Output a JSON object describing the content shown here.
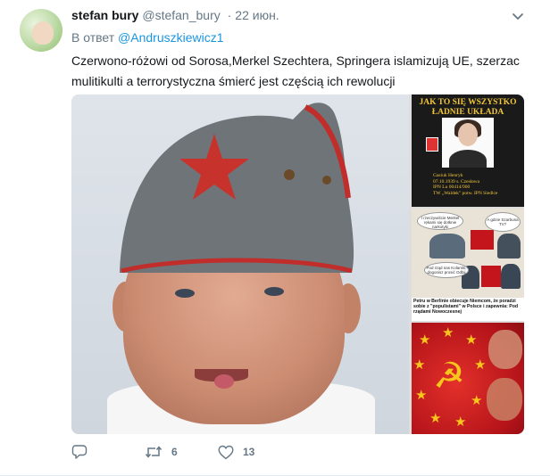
{
  "tweet": {
    "author_name": "stefan bury",
    "author_handle": "@stefan_bury",
    "separator": "·",
    "date": "22 июн.",
    "reply_prefix": "В ответ",
    "reply_to": "@Andruszkiewicz1",
    "text": "Czerwono-różowi od Sorosa,Merkel Szechtera, Springera islamizują UE,  szerzac mulitikulti a terrorystyczna śmierć jest częścią ich rewolucji"
  },
  "media": {
    "thumb1_title": "JAK TO SIĘ WSZYSTKO ŁADNIE UKŁADA",
    "thumb1_caption_lines": [
      "Gasiuk Henryk",
      "07.10.1939 s. Czesława",
      "IPN Lu 00414/900",
      "TW „Waldek\" potw. IPN Siedlce"
    ],
    "thumb2_bubble1": "I rzeczywiście Merkel rękami się dotknie narkotyki",
    "thumb2_bubble2": "A gdzie Szarbuna TV?",
    "thumb2_bubble3": "Pod rząd nas Kolarski, dogonisz prosić Odbij",
    "thumb2_bar": "Petru w Berlinie obiecuje Niemcom, że poradzi sobie z \"populistami\" w Polsce i zapewnia: Pod rządami Nowoczesnej"
  },
  "actions": {
    "reply_icon": "reply-icon",
    "retweet_icon": "retweet-icon",
    "retweet_count": "6",
    "like_icon": "heart-icon",
    "like_count": "13"
  },
  "colors": {
    "link": "#1b95e0",
    "secondary_text": "#657786",
    "primary_text": "#14171a",
    "divider": "#e6ecf0"
  }
}
